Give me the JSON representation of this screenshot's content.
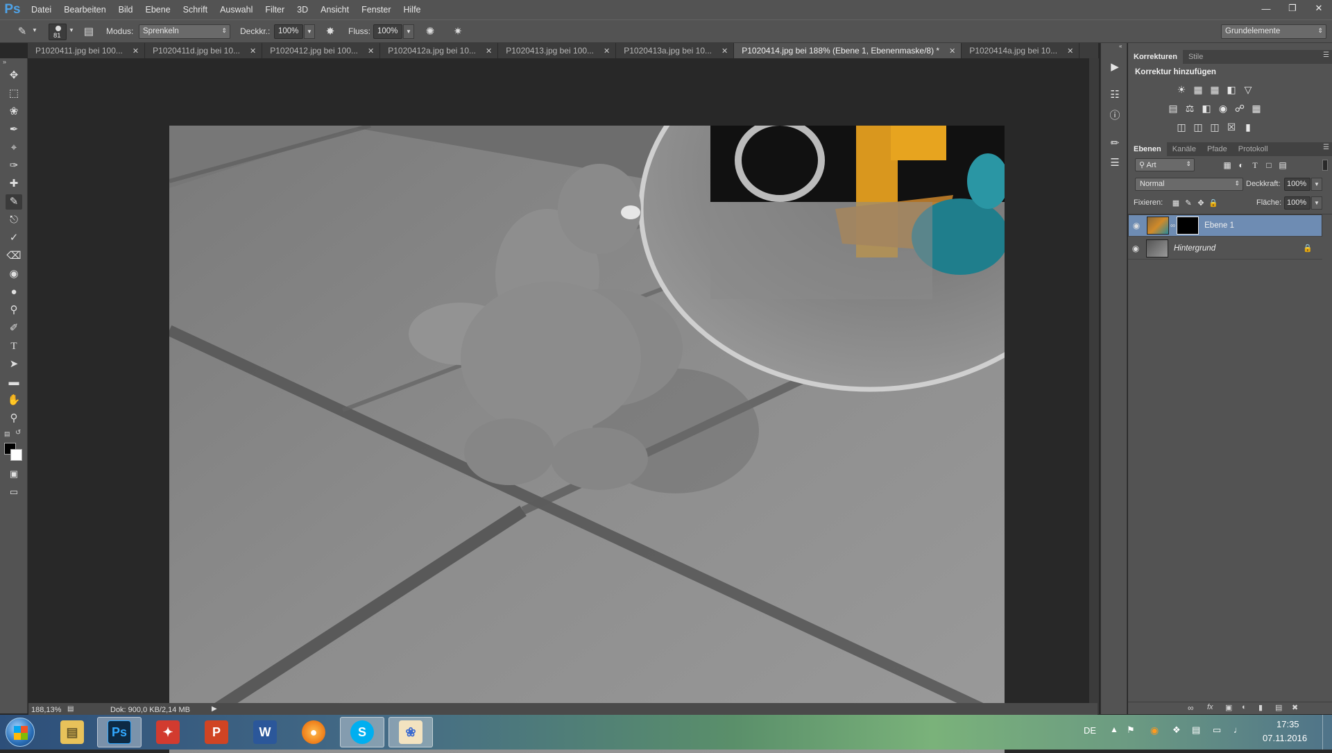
{
  "app": {
    "logo": "Ps"
  },
  "menu": [
    "Datei",
    "Bearbeiten",
    "Bild",
    "Ebene",
    "Schrift",
    "Auswahl",
    "Filter",
    "3D",
    "Ansicht",
    "Fenster",
    "Hilfe"
  ],
  "options": {
    "brush_size": "81",
    "mode_label": "Modus:",
    "mode_value": "Sprenkeln",
    "opacity_label": "Deckkr.:",
    "opacity_value": "100%",
    "flow_label": "Fluss:",
    "flow_value": "100%",
    "workspace": "Grundelemente"
  },
  "tabs": [
    {
      "name": "P1020411.jpg bei 100...",
      "active": false
    },
    {
      "name": "P1020411d.jpg bei 10...",
      "active": false
    },
    {
      "name": "P1020412.jpg bei 100...",
      "active": false
    },
    {
      "name": "P1020412a.jpg bei 10...",
      "active": false
    },
    {
      "name": "P1020413.jpg bei 100...",
      "active": false
    },
    {
      "name": "P1020413a.jpg bei 10...",
      "active": false
    },
    {
      "name": "P1020414.jpg bei 188% (Ebene 1, Ebenenmaske/8) *",
      "active": true
    },
    {
      "name": "P1020414a.jpg bei 10...",
      "active": false
    }
  ],
  "status": {
    "zoom": "188,13%",
    "doc": "Dok: 900,0 KB/2,14 MB"
  },
  "adjustments": {
    "tabs": [
      "Korrekturen",
      "Stile"
    ],
    "title": "Korrektur hinzufügen"
  },
  "layers_panel": {
    "tabs": [
      "Ebenen",
      "Kanäle",
      "Pfade",
      "Protokoll"
    ],
    "filter": "Art",
    "blend_mode": "Normal",
    "opacity_label": "Deckkraft:",
    "opacity_value": "100%",
    "lock_label": "Fixieren:",
    "fill_label": "Fläche:",
    "fill_value": "100%",
    "layers": [
      {
        "name": "Ebene 1",
        "selected": true
      },
      {
        "name": "Hintergrund",
        "selected": false
      }
    ]
  },
  "taskbar": {
    "lang": "DE",
    "time": "17:35",
    "date": "07.11.2016"
  }
}
